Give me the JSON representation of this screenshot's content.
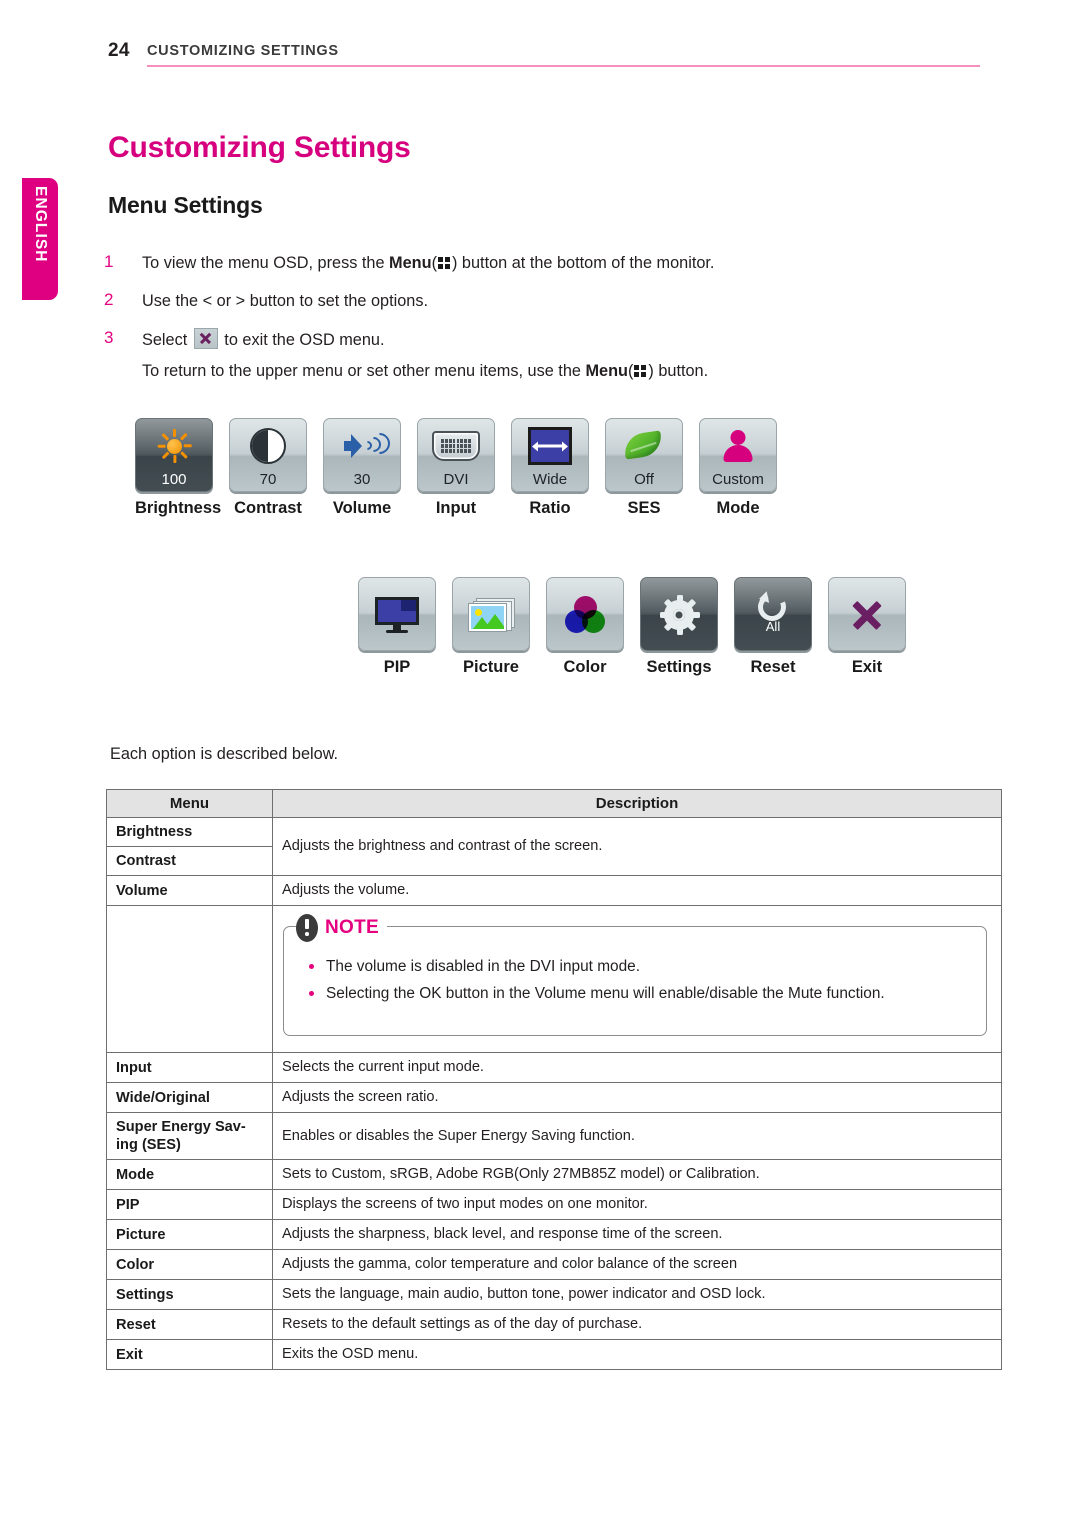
{
  "page": {
    "number": "24",
    "running_head": "CUSTOMIZING SETTINGS",
    "title": "Customizing Settings",
    "subtitle": "Menu Settings",
    "language_tab": "ENGLISH",
    "each_option_line": "Each option is described below."
  },
  "steps": [
    {
      "num": "1",
      "before": "To view the menu OSD, press the ",
      "bold": "Menu",
      "paren_open": "(",
      "icon": "menu-grid-icon",
      "paren_close": ")",
      "after": " button at the bottom of the monitor."
    },
    {
      "num": "2",
      "before": "Use the < or > button to set the options.",
      "bold": "",
      "after": ""
    },
    {
      "num": "3",
      "before": "Select ",
      "icon": "exit-x-icon",
      "after": " to exit the OSD menu.",
      "sub_before": "To return to the upper menu or set other menu items, use the ",
      "sub_bold": "Menu",
      "sub_paren_open": "(",
      "sub_icon": "menu-grid-icon",
      "sub_paren_close": ")",
      "sub_after": " button."
    }
  ],
  "osd_rows": [
    {
      "icons": [
        {
          "label": "Brightness",
          "value": "100",
          "icon": "sun-icon",
          "selected": true
        },
        {
          "label": "Contrast",
          "value": "70",
          "icon": "contrast-icon",
          "selected": false
        },
        {
          "label": "Volume",
          "value": "30",
          "icon": "speaker-icon",
          "selected": false
        },
        {
          "label": "Input",
          "value": "DVI",
          "icon": "dvi-port-icon",
          "selected": false
        },
        {
          "label": "Ratio",
          "value": "Wide",
          "icon": "aspect-ratio-icon",
          "selected": false
        },
        {
          "label": "SES",
          "value": "Off",
          "icon": "leaf-icon",
          "selected": false
        },
        {
          "label": "Mode",
          "value": "Custom",
          "icon": "person-icon",
          "selected": false
        }
      ]
    },
    {
      "icons": [
        {
          "label": "PIP",
          "value": "",
          "icon": "pip-monitor-icon",
          "selected": false
        },
        {
          "label": "Picture",
          "value": "",
          "icon": "picture-icon",
          "selected": false
        },
        {
          "label": "Color",
          "value": "",
          "icon": "color-circles-icon",
          "selected": false
        },
        {
          "label": "Settings",
          "value": "",
          "icon": "gear-icon",
          "selected": true
        },
        {
          "label": "Reset",
          "value": "All",
          "icon": "reset-arrow-icon",
          "selected": true
        },
        {
          "label": "Exit",
          "value": "",
          "icon": "x-close-icon",
          "selected": false
        }
      ]
    }
  ],
  "table": {
    "headers": {
      "menu": "Menu",
      "description": "Description"
    },
    "rows": [
      {
        "menu": "Brightness",
        "desc": "Adjusts the brightness and contrast of the screen.",
        "span": 2
      },
      {
        "menu": "Contrast",
        "desc": ""
      },
      {
        "menu": "Volume",
        "desc": "Adjusts the volume."
      },
      {
        "menu": "",
        "desc": "__NOTE__"
      },
      {
        "menu": "Input",
        "desc": "Selects the current input mode."
      },
      {
        "menu": "Wide/Original",
        "desc": "Adjusts the screen ratio."
      },
      {
        "menu": "Super Energy Sav-\ning (SES)",
        "desc": "Enables or disables the Super Energy Saving function."
      },
      {
        "menu": "Mode",
        "desc": "Sets to Custom, sRGB, Adobe RGB(Only 27MB85Z model) or Calibration."
      },
      {
        "menu": "PIP",
        "desc": "Displays the screens of two input modes on one monitor."
      },
      {
        "menu": "Picture",
        "desc": "Adjusts the sharpness, black level, and response time of the screen."
      },
      {
        "menu": "Color",
        "desc": "Adjusts the gamma, color temperature and color balance of the screen"
      },
      {
        "menu": "Settings",
        "desc": "Sets the language, main audio, button tone, power indicator and OSD lock."
      },
      {
        "menu": "Reset",
        "desc": "Resets to the default settings as of the day of purchase."
      },
      {
        "menu": "Exit",
        "desc": "Exits the OSD menu."
      }
    ]
  },
  "note": {
    "title": "NOTE",
    "icon": "exclamation-oval-icon",
    "bullets": [
      "The volume is disabled in the DVI input mode.",
      "Selecting the OK button in the Volume menu will enable/disable the Mute function."
    ]
  },
  "colors": {
    "magenta": "#d6007f",
    "pink_rule": "#f48fc0",
    "tab": "#de0081",
    "table_header_bg": "#e3e3e3"
  }
}
